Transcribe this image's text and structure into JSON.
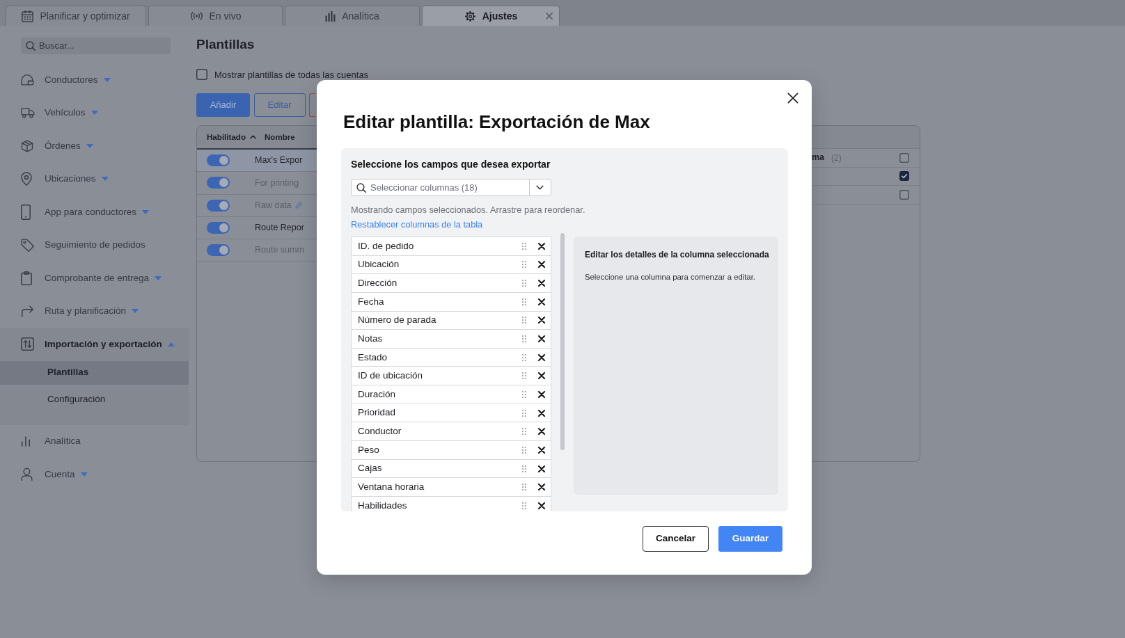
{
  "tabs": [
    {
      "label": "Planificar y optimizar",
      "selected": false
    },
    {
      "label": "En vivo",
      "selected": false
    },
    {
      "label": "Analítica",
      "selected": false
    },
    {
      "label": "Ajustes",
      "selected": true
    }
  ],
  "sidebar": {
    "search": {
      "placeholder": "Buscar..."
    },
    "items": [
      {
        "label": "Conductores",
        "kind": "menu",
        "expanded": false
      },
      {
        "label": "Vehículos",
        "kind": "menu",
        "expanded": false
      },
      {
        "label": "Órdenes",
        "kind": "menu",
        "expanded": false
      },
      {
        "label": "Ubicaciones",
        "kind": "menu",
        "expanded": false
      },
      {
        "label": "App para conductores",
        "kind": "menu",
        "expanded": false
      },
      {
        "label": "Seguimiento de pedidos",
        "kind": "link",
        "expanded": false
      },
      {
        "label": "Comprobante de entrega",
        "kind": "menu",
        "expanded": false
      },
      {
        "label": "Ruta y planificación",
        "kind": "menu",
        "expanded": false
      },
      {
        "label": "Importación y exportación",
        "kind": "menu",
        "expanded": true,
        "children": [
          {
            "label": "Plantillas",
            "selected": true
          },
          {
            "label": "Configuración",
            "selected": false
          }
        ]
      },
      {
        "label": "Analítica",
        "kind": "link",
        "expanded": false
      },
      {
        "label": "Cuenta",
        "kind": "menu",
        "expanded": false
      }
    ]
  },
  "page": {
    "title": "Plantillas",
    "show_all": {
      "label": "Mostrar plantillas de todas las cuentas",
      "checked": false
    },
    "buttons": [
      {
        "label": "Añadir",
        "kind": "primary"
      },
      {
        "label": "Editar",
        "kind": "outline"
      },
      {
        "kind": "danger"
      }
    ]
  },
  "table": {
    "columns": [
      {
        "label": "Habilitado",
        "sorted_ascending": true
      },
      {
        "label": "Nombre"
      }
    ],
    "rows": [
      {
        "name": "Max's Expor",
        "enabled": true,
        "selected": true,
        "muted": false,
        "editable": false
      },
      {
        "name": "For printing",
        "enabled": true,
        "selected": false,
        "muted": true,
        "editable": false
      },
      {
        "name": "Raw data",
        "enabled": true,
        "selected": false,
        "muted": true,
        "editable": true
      },
      {
        "name": "Route Repor",
        "enabled": true,
        "selected": false,
        "muted": false,
        "editable": false
      },
      {
        "name": "Route summ",
        "enabled": true,
        "selected": false,
        "muted": true,
        "editable": false
      }
    ],
    "right_rows": [
      {
        "column_3": "ma",
        "count": "(2)",
        "checked": false
      },
      {
        "checked": true
      },
      {
        "checked": false
      }
    ]
  },
  "modal": {
    "title": "Editar plantilla: Exportación de Max",
    "fields_section": {
      "heading": "Seleccione los campos que desea exportar",
      "column_select": {
        "placeholder": "Seleccionar columnas (18)"
      },
      "hint": "Mostrando campos seleccionados. Arrastre para reordenar.",
      "reset_link": "Restablecer columnas de la tabla",
      "fields": [
        "ID. de pedido",
        "Ubicación",
        "Dirección",
        "Fecha",
        "Número de parada",
        "Notas",
        "Estado",
        "ID de ubicación",
        "Duración",
        "Prioridad",
        "Conductor",
        "Peso",
        "Cajas",
        "Ventana horaria",
        "Habilidades"
      ]
    },
    "details": {
      "heading": "Editar los detalles de la columna seleccionada",
      "hint": "Seleccione una columna para comenzar a editar."
    },
    "buttons": [
      {
        "label": "Cancelar",
        "kind": "secondary"
      },
      {
        "label": "Guardar",
        "kind": "primary"
      }
    ]
  }
}
